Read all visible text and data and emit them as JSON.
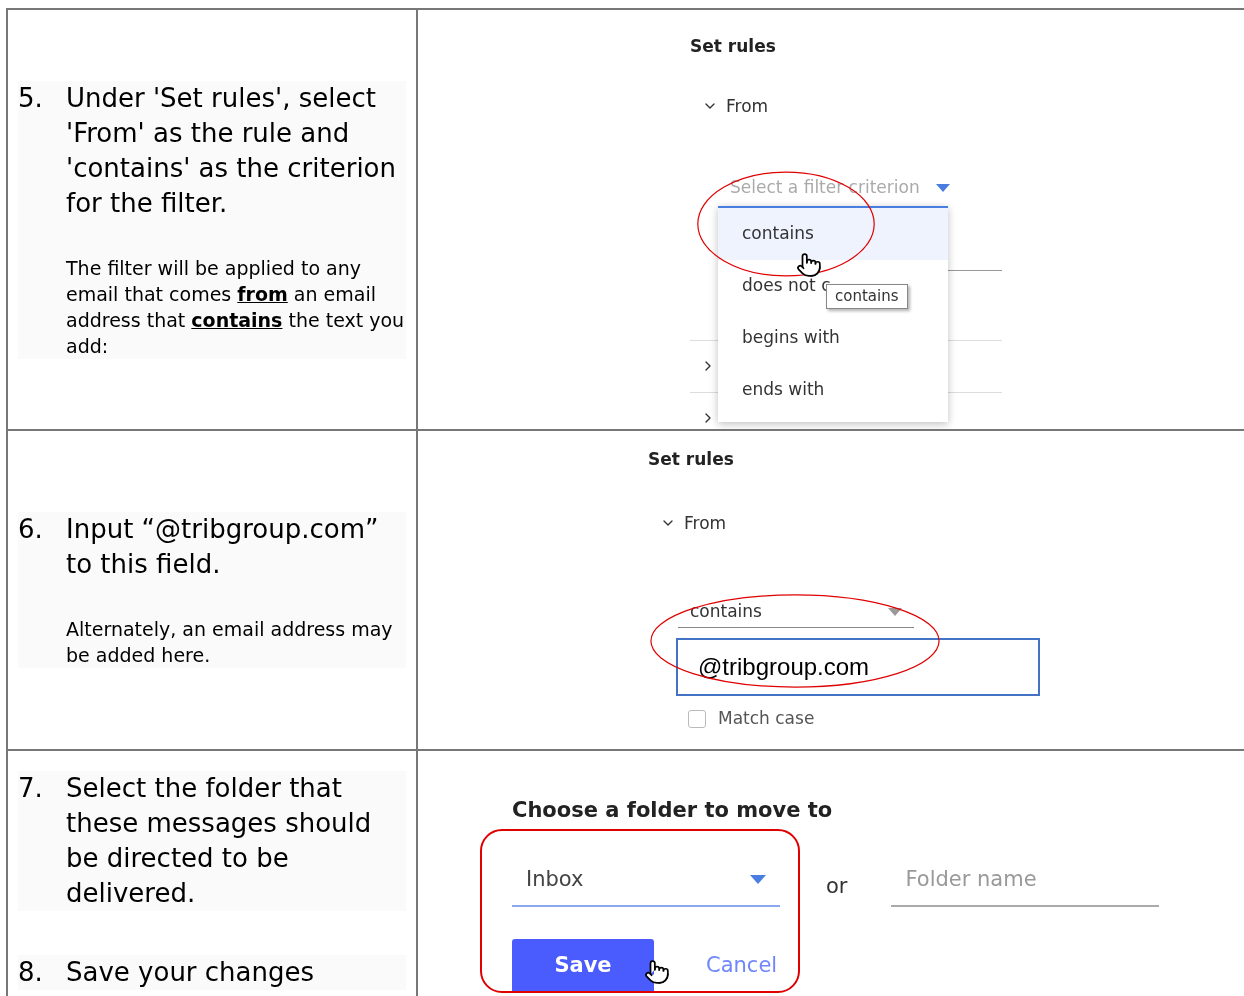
{
  "rows": [
    {
      "steps": [
        {
          "number": "5.",
          "text": "Under 'Set rules', select 'From' as the rule and 'contains' as the criterion for the filter.",
          "note": "The filter will be applied to any email that comes **from** an email address that **contains** the text you add:"
        }
      ],
      "panel": {
        "kind": "criterion_menu",
        "title": "Set rules",
        "section": {
          "label": "From",
          "expanded": true
        },
        "select": {
          "placeholder": "Select a filter criterion"
        },
        "options": [
          {
            "label": "contains",
            "selected": true
          },
          {
            "label": "does not c",
            "selected": false
          },
          {
            "label": "begins with",
            "selected": false
          },
          {
            "label": "ends with",
            "selected": false
          }
        ],
        "tooltip": "contains"
      }
    },
    {
      "steps": [
        {
          "number": "6.",
          "text": "Input “@tribgroup.com” to this field.",
          "note": "Alternately, an email address may be added here."
        }
      ],
      "panel": {
        "kind": "criterion_value",
        "title": "Set rules",
        "section": {
          "label": "From",
          "expanded": true
        },
        "select": {
          "value": "contains"
        },
        "input": {
          "value": "@tribgroup.com"
        },
        "checkbox": {
          "label": "Match case",
          "checked": false
        }
      }
    },
    {
      "steps": [
        {
          "number": "7.",
          "text": "Select the folder that these messages should be directed to be delivered."
        },
        {
          "number": "8.",
          "text": "Save your changes"
        }
      ],
      "panel": {
        "kind": "folder_choice",
        "title": "Choose a folder to move to",
        "select": {
          "value": "Inbox"
        },
        "separator": "or",
        "folder_field": {
          "placeholder": "Folder name"
        },
        "buttons": [
          {
            "label": "Save",
            "kind": "primary"
          },
          {
            "label": "Cancel",
            "kind": "link"
          }
        ]
      }
    }
  ]
}
